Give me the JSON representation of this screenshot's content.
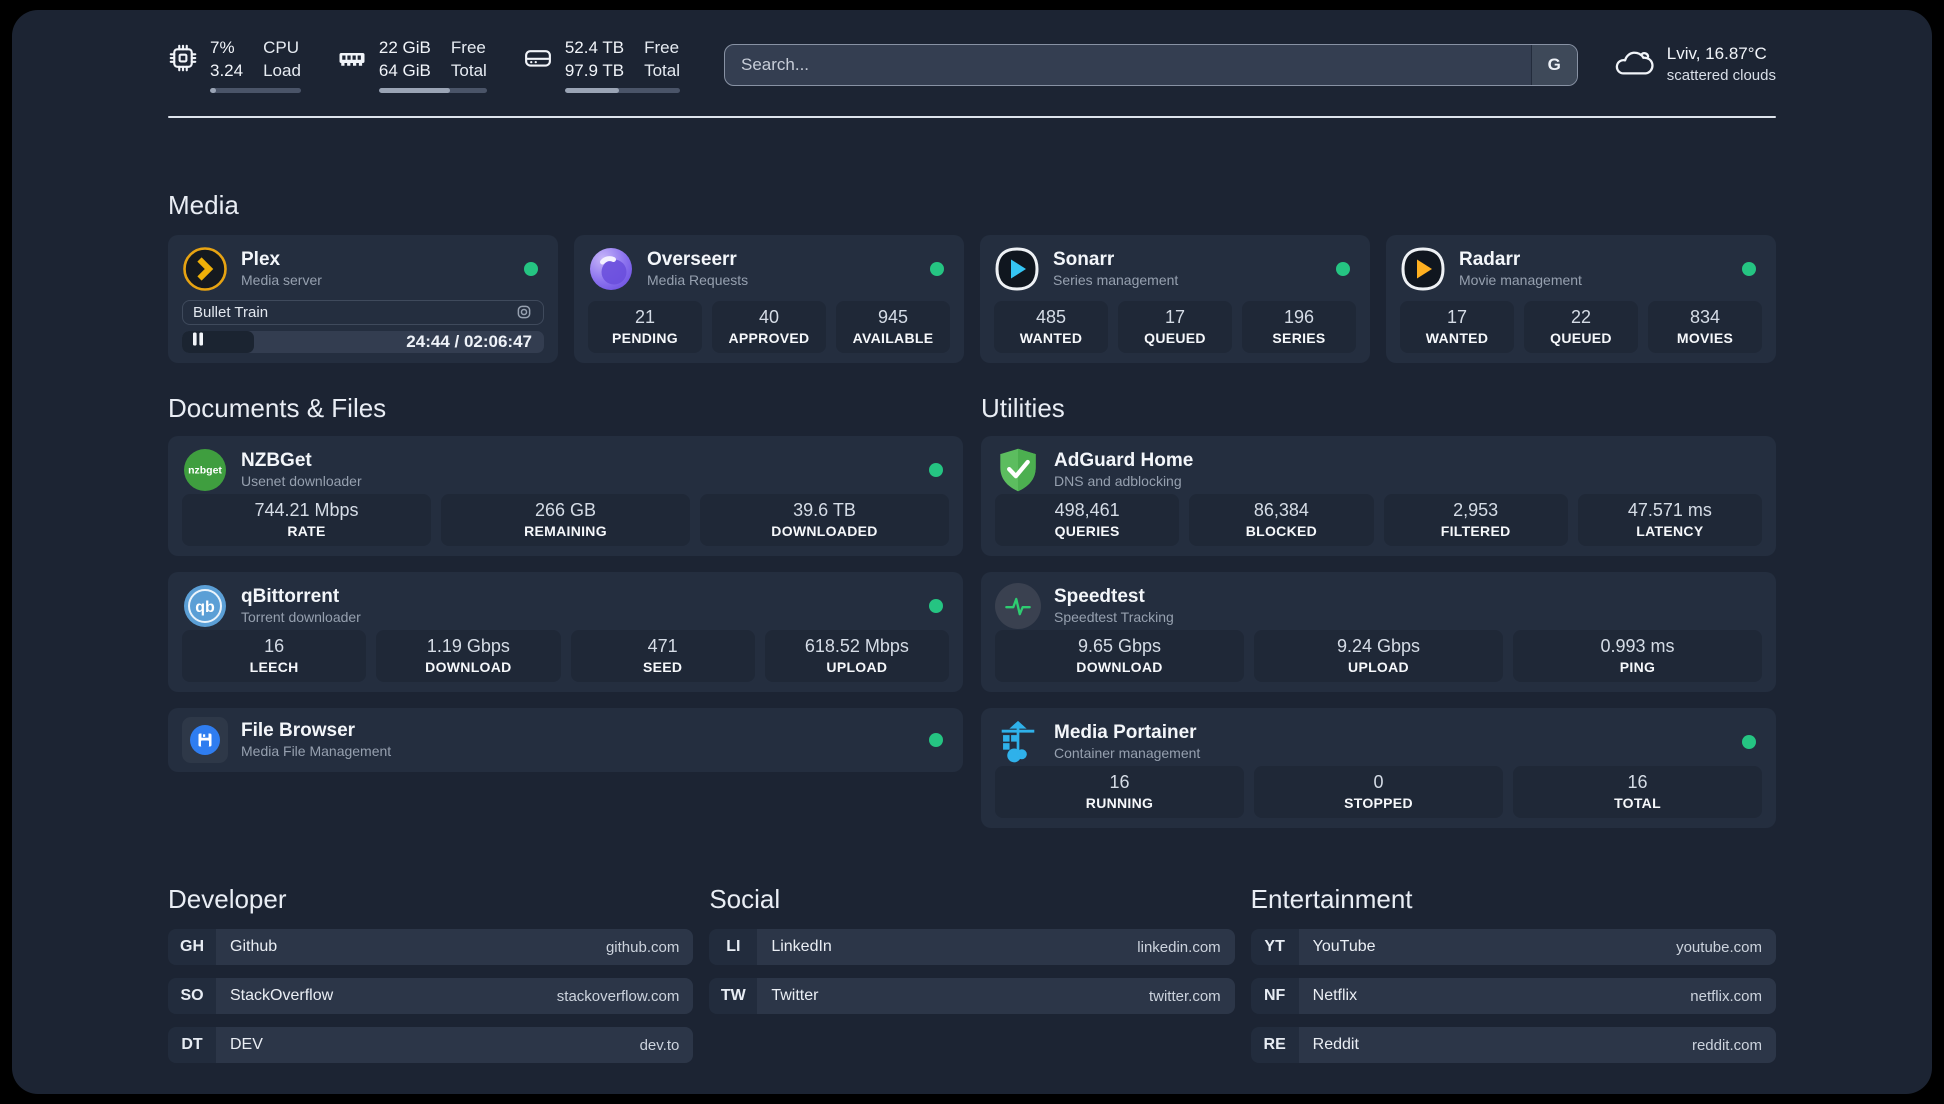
{
  "topbar": {
    "system": [
      {
        "icon": "cpu-chip-icon",
        "values": [
          "7%",
          "3.24"
        ],
        "labels": [
          "CPU",
          "Load"
        ],
        "usage_percent": 7
      },
      {
        "icon": "ram-icon",
        "values": [
          "22 GiB",
          "64 GiB"
        ],
        "labels": [
          "Free",
          "Total"
        ],
        "usage_percent": 66
      },
      {
        "icon": "hard-drive-icon",
        "values": [
          "52.4 TB",
          "97.9 TB"
        ],
        "labels": [
          "Free",
          "Total"
        ],
        "usage_percent": 47
      }
    ],
    "search": {
      "placeholder": "Search...",
      "button_label": "G"
    },
    "weather": {
      "location_temp": "Lviv, 16.87°C",
      "condition": "scattered clouds"
    }
  },
  "colors": {
    "page_bg": "#1c2433",
    "card_bg": "#242e3f",
    "status_green": "#25c482"
  },
  "sections": {
    "media": {
      "title": "Media",
      "plex": {
        "name": "Plex",
        "subtitle": "Media server",
        "status": "online",
        "now_playing": {
          "title": "Bullet Train",
          "time_display": "24:44 / 02:06:47",
          "progress_percent": 20
        }
      },
      "overseerr": {
        "name": "Overseerr",
        "subtitle": "Media Requests",
        "status": "online",
        "stats": [
          {
            "value": "21",
            "label": "PENDING"
          },
          {
            "value": "40",
            "label": "APPROVED"
          },
          {
            "value": "945",
            "label": "AVAILABLE"
          }
        ]
      },
      "sonarr": {
        "name": "Sonarr",
        "subtitle": "Series management",
        "status": "online",
        "stats": [
          {
            "value": "485",
            "label": "WANTED"
          },
          {
            "value": "17",
            "label": "QUEUED"
          },
          {
            "value": "196",
            "label": "SERIES"
          }
        ]
      },
      "radarr": {
        "name": "Radarr",
        "subtitle": "Movie management",
        "status": "online",
        "stats": [
          {
            "value": "17",
            "label": "WANTED"
          },
          {
            "value": "22",
            "label": "QUEUED"
          },
          {
            "value": "834",
            "label": "MOVIES"
          }
        ]
      }
    },
    "documents": {
      "title": "Documents & Files",
      "nzbget": {
        "name": "NZBGet",
        "subtitle": "Usenet downloader",
        "status": "online",
        "icon_text": "nzbget",
        "stats": [
          {
            "value": "744.21 Mbps",
            "label": "RATE"
          },
          {
            "value": "266 GB",
            "label": "REMAINING"
          },
          {
            "value": "39.6 TB",
            "label": "DOWNLOADED"
          }
        ]
      },
      "qbittorrent": {
        "name": "qBittorrent",
        "subtitle": "Torrent downloader",
        "status": "online",
        "icon_text": "qb",
        "stats": [
          {
            "value": "16",
            "label": "LEECH"
          },
          {
            "value": "1.19 Gbps",
            "label": "DOWNLOAD"
          },
          {
            "value": "471",
            "label": "SEED"
          },
          {
            "value": "618.52 Mbps",
            "label": "UPLOAD"
          }
        ]
      },
      "filebrowser": {
        "name": "File Browser",
        "subtitle": "Media File Management",
        "status": "online"
      }
    },
    "utilities": {
      "title": "Utilities",
      "adguard": {
        "name": "AdGuard Home",
        "subtitle": "DNS and adblocking",
        "stats": [
          {
            "value": "498,461",
            "label": "QUERIES"
          },
          {
            "value": "86,384",
            "label": "BLOCKED"
          },
          {
            "value": "2,953",
            "label": "FILTERED"
          },
          {
            "value": "47.571 ms",
            "label": "LATENCY"
          }
        ]
      },
      "speedtest": {
        "name": "Speedtest",
        "subtitle": "Speedtest Tracking",
        "stats": [
          {
            "value": "9.65 Gbps",
            "label": "DOWNLOAD"
          },
          {
            "value": "9.24 Gbps",
            "label": "UPLOAD"
          },
          {
            "value": "0.993 ms",
            "label": "PING"
          }
        ]
      },
      "portainer": {
        "name": "Media Portainer",
        "subtitle": "Container management",
        "status": "online",
        "stats": [
          {
            "value": "16",
            "label": "RUNNING"
          },
          {
            "value": "0",
            "label": "STOPPED"
          },
          {
            "value": "16",
            "label": "TOTAL"
          }
        ]
      }
    },
    "links": {
      "developer": {
        "title": "Developer",
        "items": [
          {
            "abbr": "GH",
            "name": "Github",
            "url": "github.com"
          },
          {
            "abbr": "SO",
            "name": "StackOverflow",
            "url": "stackoverflow.com"
          },
          {
            "abbr": "DT",
            "name": "DEV",
            "url": "dev.to"
          }
        ]
      },
      "social": {
        "title": "Social",
        "items": [
          {
            "abbr": "LI",
            "name": "LinkedIn",
            "url": "linkedin.com"
          },
          {
            "abbr": "TW",
            "name": "Twitter",
            "url": "twitter.com"
          }
        ]
      },
      "entertainment": {
        "title": "Entertainment",
        "items": [
          {
            "abbr": "YT",
            "name": "YouTube",
            "url": "youtube.com"
          },
          {
            "abbr": "NF",
            "name": "Netflix",
            "url": "netflix.com"
          },
          {
            "abbr": "RE",
            "name": "Reddit",
            "url": "reddit.com"
          }
        ]
      }
    }
  }
}
